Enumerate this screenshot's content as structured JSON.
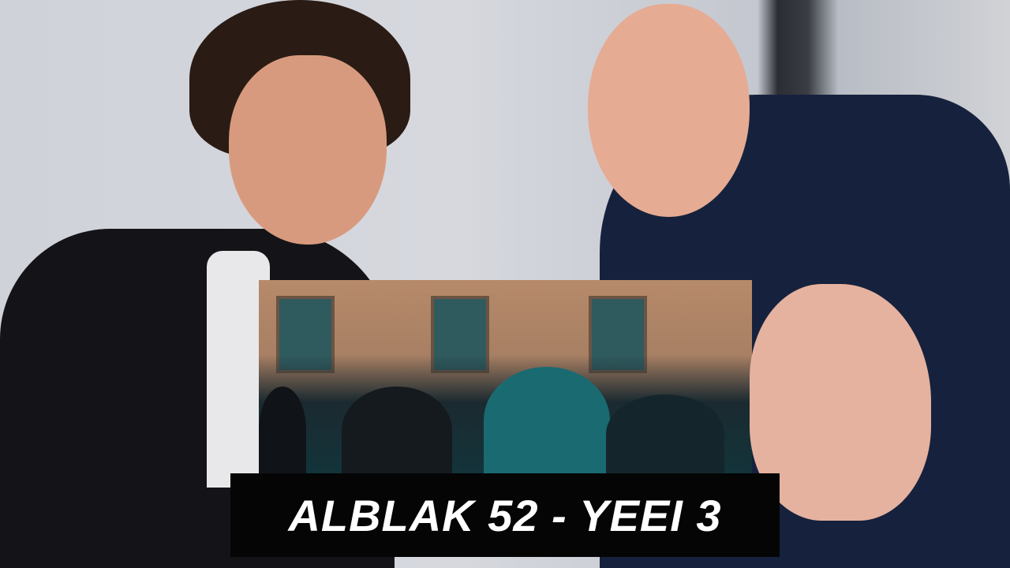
{
  "thumbnail": {
    "title": "ALBLAK 52 - YEEI 3"
  }
}
